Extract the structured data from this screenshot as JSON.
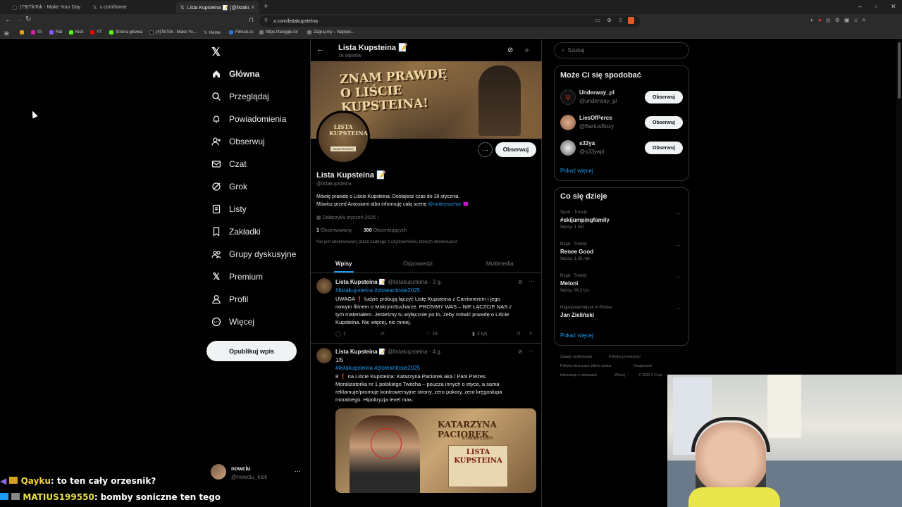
{
  "browser": {
    "tabs": [
      {
        "label": "(79)TikTok - Make Your Day"
      },
      {
        "label": "x.com/home"
      },
      {
        "label": "Lista Kupsteina 📝 (@listakupstei..."
      }
    ],
    "url": "x.com/listakupsteina",
    "bookmarks": [
      "IG",
      "Rat",
      "Kick",
      "YT",
      "Strona główna",
      "(4)TikTok - Make Yo...",
      "Home",
      "Filman.cc",
      "https://tanggle.io/",
      "Zagraj.my – Najleps..."
    ]
  },
  "nav": {
    "items": [
      "Główna",
      "Przeglądaj",
      "Powiadomienia",
      "Obserwuj",
      "Czat",
      "Grok",
      "Listy",
      "Zakładki",
      "Grupy dyskusyjne",
      "Premium",
      "Profil",
      "Więcej"
    ],
    "post_label": "Opublikuj wpis",
    "account": {
      "name": "nowciu",
      "handle": "@nowciu_kick"
    }
  },
  "profile": {
    "header_name": "Lista Kupsteina 📝",
    "post_count": "16 wpisów",
    "banner_text": "ZNAM PRAWDĘ O LIŚCIE KUPSTEINA!",
    "avatar_text": "LISTA KUPSTEINA",
    "avatar_subtext": "ZNAM PRAWDĘ",
    "name": "Lista Kupsteina 📝",
    "handle": "@listakupsteina",
    "bio_line1": "Mówię prawdę o Liście Kupsteina. Dostajesz czas do 18 stycznia.",
    "bio_line2_pre": "Mówisz przed Antosiami albo informuję całą scenę ",
    "bio_mention": "@mokrysuchar",
    "bio_emoji": "😈",
    "joined": "Dołączył/a styczeń 2026",
    "following_count": "1",
    "following_label": "Obserwowany",
    "followers_count": "300",
    "followers_label": "Obserwujących",
    "not_followed_note": "Nie jest obserwowany przez żadnego z użytkowników, których obserwujesz",
    "follow_label": "Obserwuj",
    "tabs": [
      "Wpisy",
      "Odpowiedzi",
      "Multimedia"
    ]
  },
  "tweets": [
    {
      "name": "Lista Kupsteina 📝",
      "meta": "@listakupsteina · 3 g.",
      "hashtags": "#listakupsteina #zloteantosie2025",
      "lines": [
        "UWAGA ❗ ludzie próbują łączyć Listę Kupsteina z Carrionerem i jego",
        "nowym filmem o MokrymSucharze. PROSIMY WAS – NIE ŁĄCZCIE NAS z",
        "tym materiałem. Jesteśmy tu wyłącznie po to, żeby mówić prawdę o Liście",
        "Kupsteina. Nic więcej, nic mniej."
      ],
      "stats": {
        "replies": "1",
        "reposts": "",
        "likes": "18",
        "views": "2 tys."
      }
    },
    {
      "name": "Lista Kupsteina 📝",
      "meta": "@listakupsteina · 4 g.",
      "counter": "1/5",
      "hashtags": "#listakupsteina #zloteantosie2025",
      "lines": [
        "8 ❗ na Liście Kupsteina: Katarzyna Paciorek aka / Pani Prezes.",
        "Moralizatorka nr 1 polskiego Twitcha – poucza innych o etyce, a sama",
        "reklamuje/promuje kontrowersyjne strony, zero pokory, zero kręgosłupa",
        "moralnego. Hipokryzja level max."
      ],
      "image_title": "KATARZYNA PACIOREK",
      "image_sub": "8. OSOBA Z LISTY",
      "image_list": "LISTA KUPSTEINA"
    }
  ],
  "right": {
    "search_placeholder": "Szukaj",
    "who_to_follow_title": "Może Ci się spodobać",
    "suggestions": [
      {
        "name": "Underway_pl",
        "handle": "@underway_pl"
      },
      {
        "name": "LiesOfPercs",
        "handle": "@BartusBozy"
      },
      {
        "name": "s33ya",
        "handle": "@s33yapl"
      }
    ],
    "follow_label": "Obserwuj",
    "show_more": "Pokaż więcej",
    "trends_title": "Co się dzieje",
    "trends": [
      {
        "category": "Sport · Trendy",
        "topic": "#skijumpingfamily",
        "count": "Wpisy: 1 461"
      },
      {
        "category": "Rząd · Trendy",
        "topic": "Renee Good",
        "count": "Wpisy: 1,05 mln"
      },
      {
        "category": "Rząd · Trendy",
        "topic": "Meloni",
        "count": "Wpisy: 96,2 tys."
      },
      {
        "category": "Najpopularniejsze w Polska",
        "topic": "Jan Zieliński",
        "count": ""
      }
    ],
    "footer": [
      "Zasady użytkowania",
      "Polityka prywatności",
      "Polityka dotycząca plików cookie",
      "Dostępność",
      "Informacja o reklamach",
      "Więcej ···",
      "© 2026 X Corp."
    ]
  },
  "chat": [
    {
      "user": "Qayku",
      "message": ": to ten cały orzesnik?",
      "color": "#f0d23c"
    },
    {
      "user": "MATIUS199550",
      "message": ": bomby soniczne ten tego",
      "color": "#e8e04a"
    }
  ]
}
